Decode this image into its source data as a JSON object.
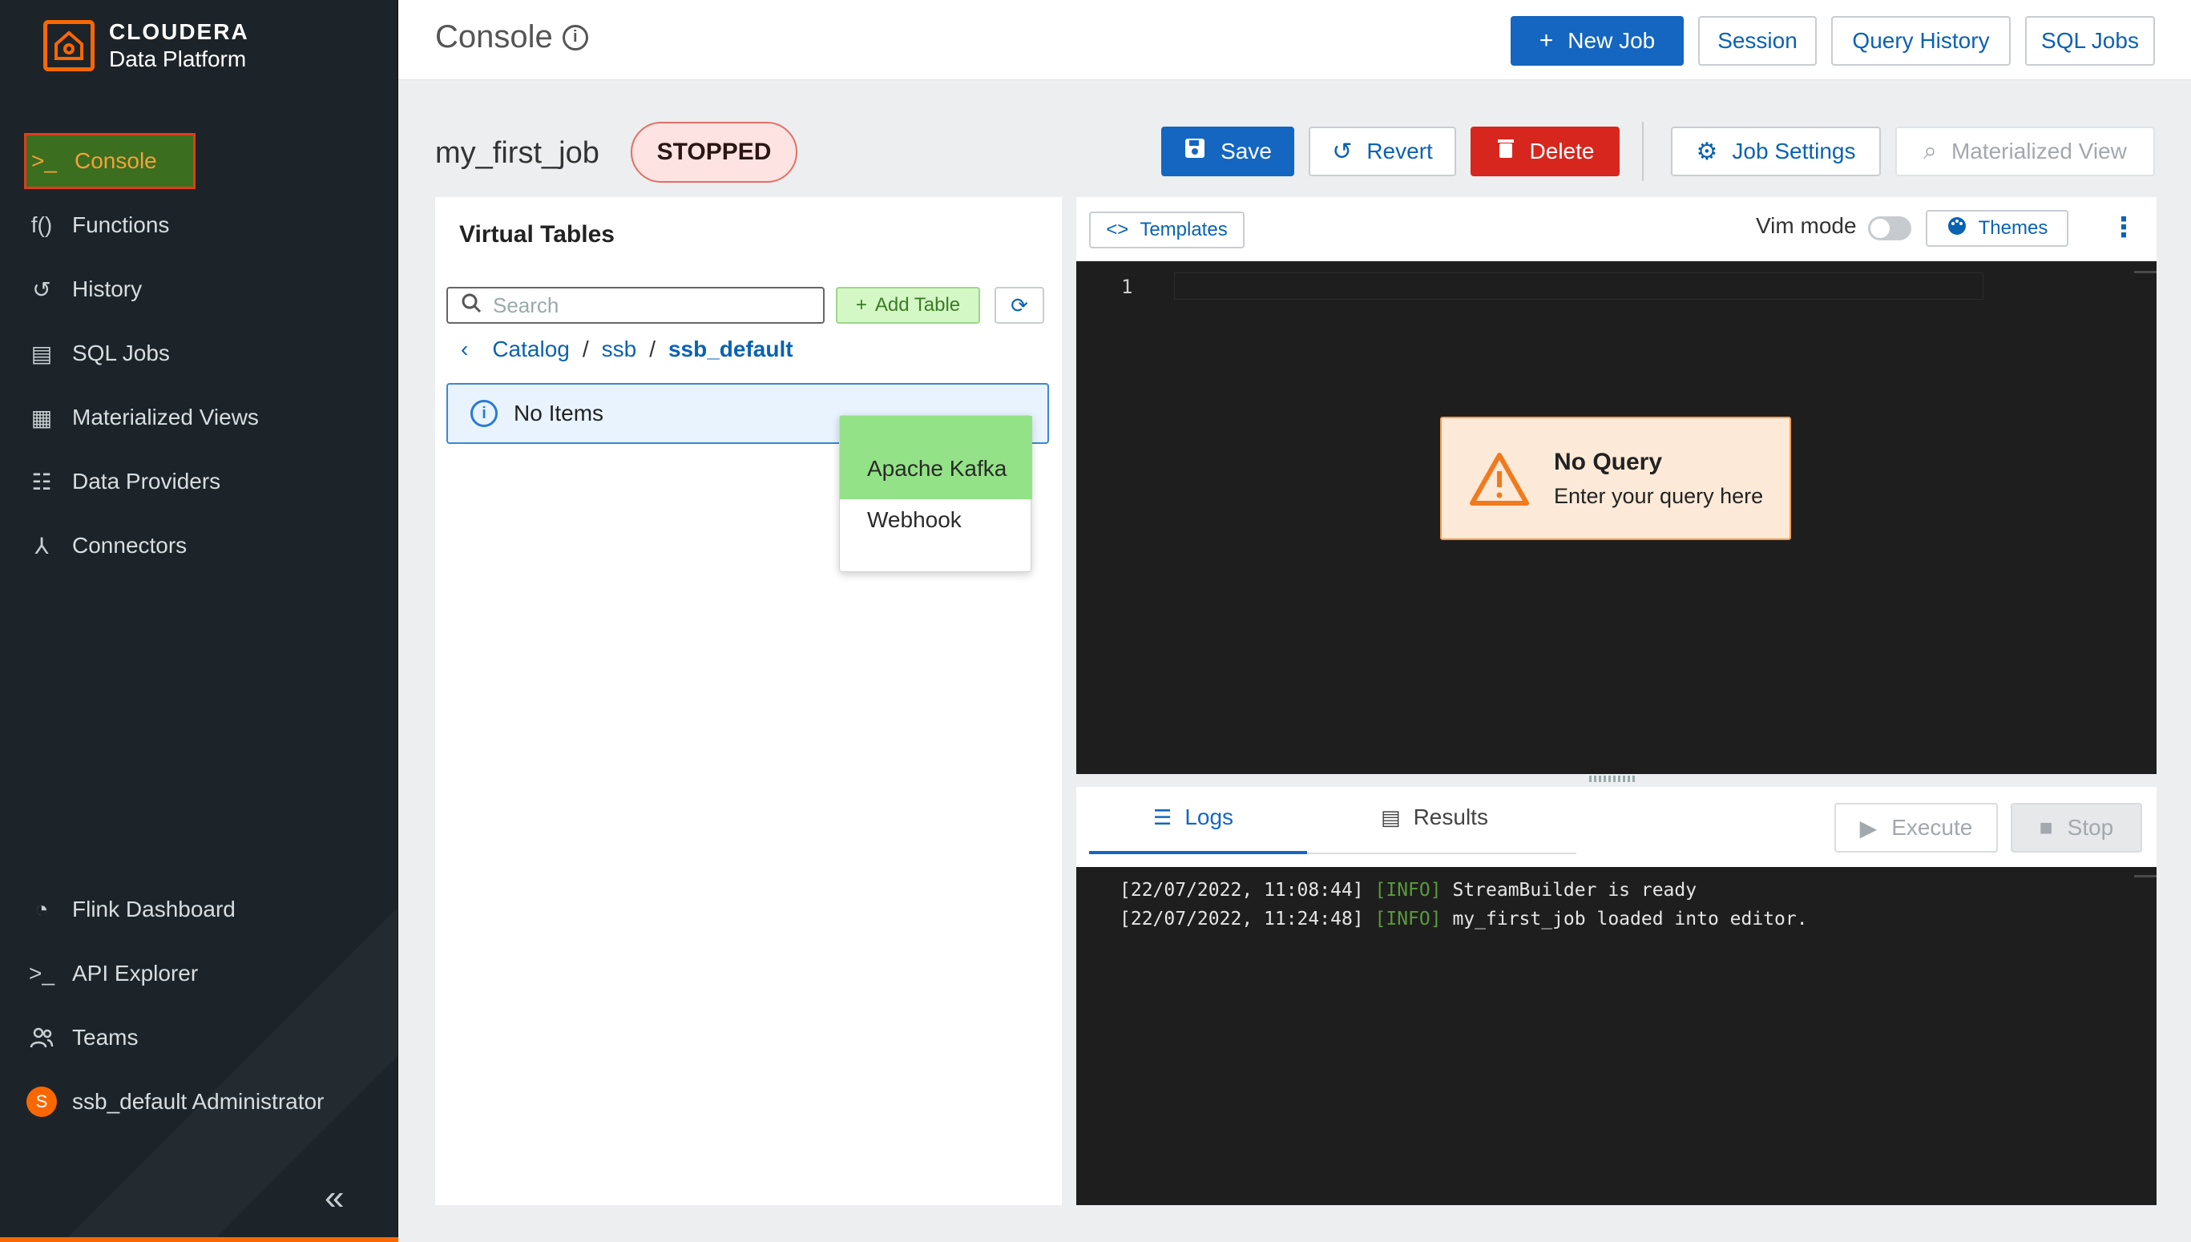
{
  "brand": {
    "name": "CLOUDERA",
    "product": "Data Platform"
  },
  "colors": {
    "brand_orange": "#f96702",
    "primary_blue": "#1466c0",
    "danger_red": "#d7261e",
    "sidebar_bg": "#1d2429"
  },
  "sidebar": {
    "items": [
      {
        "label": "Console",
        "icon": "terminal-icon",
        "glyph": ">_"
      },
      {
        "label": "Functions",
        "icon": "function-icon",
        "glyph": "f()"
      },
      {
        "label": "History",
        "icon": "history-icon",
        "glyph": "↺"
      },
      {
        "label": "SQL Jobs",
        "icon": "sql-jobs-icon",
        "glyph": "▤"
      },
      {
        "label": "Materialized Views",
        "icon": "materialized-views-icon",
        "glyph": "▦"
      },
      {
        "label": "Data Providers",
        "icon": "data-providers-icon",
        "glyph": "☷"
      },
      {
        "label": "Connectors",
        "icon": "connectors-icon",
        "glyph": "⅄"
      }
    ],
    "bottom_items": [
      {
        "label": "Flink Dashboard",
        "icon": "dashboard-icon",
        "glyph": "◔"
      },
      {
        "label": "API Explorer",
        "icon": "terminal-icon",
        "glyph": ">_"
      },
      {
        "label": "Teams",
        "icon": "teams-icon",
        "glyph": "👥"
      }
    ],
    "user": {
      "initial": "S",
      "label": "ssb_default Administrator"
    },
    "collapse_glyph": "«"
  },
  "topbar": {
    "title": "Console",
    "new_job": "New Job",
    "session": "Session",
    "query_history": "Query History",
    "sql_jobs": "SQL Jobs"
  },
  "job": {
    "name": "my_first_job",
    "status": "STOPPED",
    "save": "Save",
    "revert": "Revert",
    "delete": "Delete",
    "job_settings": "Job Settings",
    "materialized_view": "Materialized View"
  },
  "virtual_tables": {
    "title": "Virtual Tables",
    "search_placeholder": "Search",
    "add_table": "Add Table",
    "breadcrumb": {
      "root": "Catalog",
      "catalog": "ssb",
      "database": "ssb_default"
    },
    "empty_message": "No Items",
    "dropdown": [
      "Apache Kafka",
      "Webhook"
    ]
  },
  "editor": {
    "templates": "Templates",
    "vim_mode": "Vim mode",
    "vim_mode_on": false,
    "themes": "Themes",
    "line_number": "1",
    "no_query_title": "No Query",
    "no_query_sub": "Enter your query here"
  },
  "logs": {
    "tab_logs": "Logs",
    "tab_results": "Results",
    "execute": "Execute",
    "stop": "Stop",
    "lines": [
      {
        "ts": "[22/07/2022, 11:08:44]",
        "level": "[INFO]",
        "msg": "StreamBuilder is ready"
      },
      {
        "ts": "[22/07/2022, 11:24:48]",
        "level": "[INFO]",
        "msg": "my_first_job loaded into editor."
      }
    ]
  }
}
